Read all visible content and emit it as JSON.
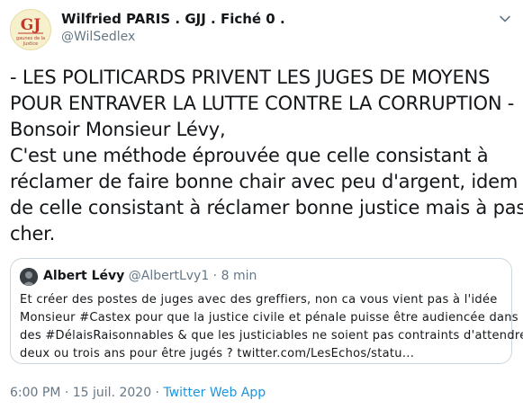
{
  "author": {
    "display_name": "Wilfried PARIS . GJJ . Fiché 0 .",
    "handle": "@WilSedlex",
    "avatar_text": "GJ gaunes de la Justice"
  },
  "tweet": {
    "lines": [
      "- LES POLITICARDS PRIVENT LES JUGES DE MOYENS",
      "POUR ENTRAVER LA LUTTE CONTRE LA CORRUPTION -",
      "Bonsoir Monsieur Lévy,",
      "C'est une méthode éprouvée que celle consistant à",
      "réclamer de faire bonne chair avec peu d'argent, idem",
      "de celle consistant à réclamer bonne justice mais à pas",
      "cher."
    ]
  },
  "quoted": {
    "display_name": "Albert Lévy",
    "meta": " @AlbertLvy1 · 8 min",
    "lines": [
      "Et créer des postes de juges avec des greffiers, non ca vous vient pas à l'idée",
      "Monsieur #Castex pour que la justice civile et pénale puisse être audiencée dans",
      "des #DélaisRaisonnables & que les justiciables ne soient pas contraints d'attendre",
      "deux ou trois ans pour être jugés ? twitter.com/LesEchos/statu..."
    ]
  },
  "meta": {
    "timestamp": "6:00 PM · 15 juil. 2020 · ",
    "source": "Twitter Web App"
  },
  "icons": {
    "menu": "chevron-down-icon"
  },
  "colors": {
    "text": "#14171a",
    "secondary": "#657786",
    "link": "#1b95e0",
    "border": "#ccd6dd"
  }
}
